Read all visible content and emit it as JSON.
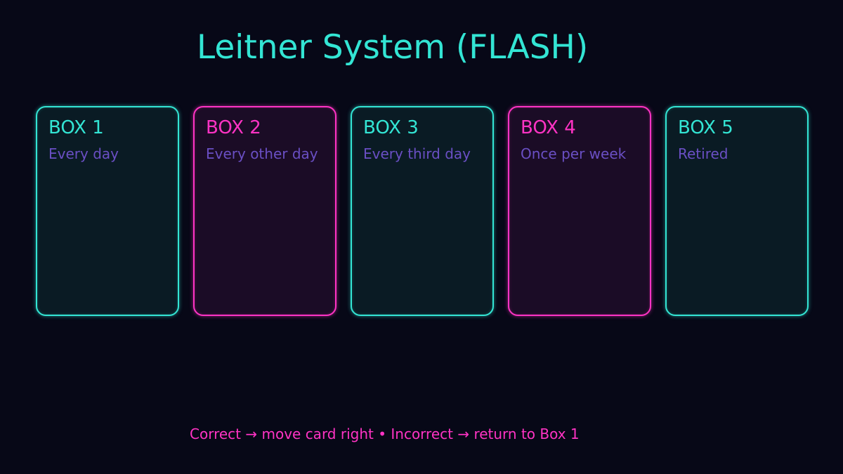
{
  "title": "Leitner System (FLASH)",
  "boxes": [
    {
      "name": "BOX 1",
      "schedule": "Every day",
      "accent": "cyan"
    },
    {
      "name": "BOX 2",
      "schedule": "Every other day",
      "accent": "magenta"
    },
    {
      "name": "BOX 3",
      "schedule": "Every third day",
      "accent": "cyan"
    },
    {
      "name": "BOX 4",
      "schedule": "Once per week",
      "accent": "magenta"
    },
    {
      "name": "BOX 5",
      "schedule": "Retired",
      "accent": "cyan"
    }
  ],
  "footer": "Correct → move card right • Incorrect → return to Box 1",
  "colors": {
    "background": "#070817",
    "cyan": "#33e5d4",
    "magenta": "#ff33c4",
    "description": "#6a4fc4"
  }
}
